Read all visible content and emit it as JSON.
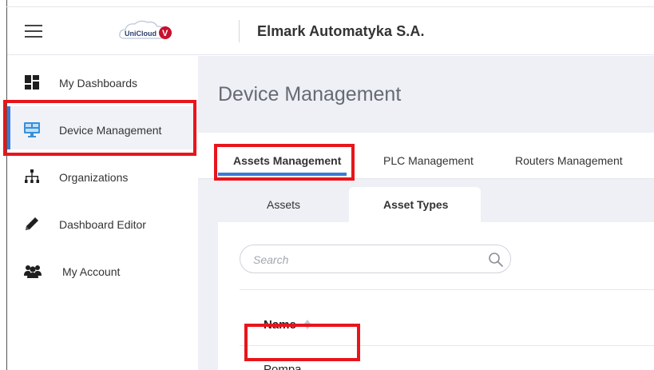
{
  "header": {
    "company": "Elmark Automatyka S.A.",
    "logo_text": "UniCloud",
    "logo_badge": "V"
  },
  "sidebar": {
    "items": [
      {
        "label": "My Dashboards",
        "icon": "dashboard-icon"
      },
      {
        "label": "Device Management",
        "icon": "device-management-icon",
        "active": true
      },
      {
        "label": "Organizations",
        "icon": "org-chart-icon"
      },
      {
        "label": "Dashboard Editor",
        "icon": "pencil-icon"
      },
      {
        "label": "My Account",
        "icon": "users-icon"
      }
    ]
  },
  "main": {
    "title": "Device Management",
    "tabs": [
      {
        "label": "Assets Management",
        "active": true
      },
      {
        "label": "PLC Management"
      },
      {
        "label": "Routers Management"
      }
    ],
    "subtabs": [
      {
        "label": "Assets"
      },
      {
        "label": "Asset Types",
        "active": true
      }
    ],
    "search": {
      "placeholder": "Search",
      "value": ""
    },
    "table": {
      "columns": [
        "Name"
      ],
      "rows": [
        [
          "Pompa"
        ]
      ]
    }
  },
  "colors": {
    "accent": "#3a7bd5",
    "annotation": "#e8151b",
    "background": "#eef0f5"
  }
}
